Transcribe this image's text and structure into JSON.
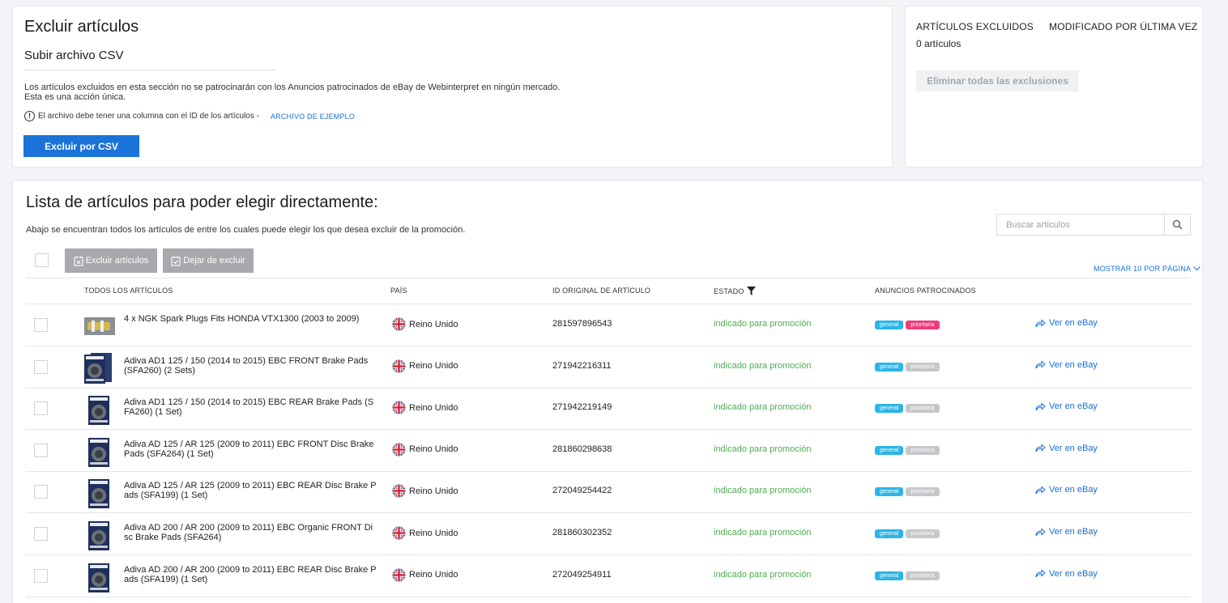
{
  "exclude_section": {
    "title": "Excluir artículos",
    "subtitle": "Subir archivo CSV",
    "description_line1": "Los artículos excluidos en esta sección no se patrocinarán con los Anuncios patrocinados de eBay de Webinterpret en ningún mercado.",
    "description_line2": "Esta es una acción única.",
    "note": "El archivo debe tener una columna con el ID de los artículos -",
    "sample_link": "ARCHIVO DE EJEMPLO",
    "button_label": "Excluir por CSV"
  },
  "summary": {
    "excluded_header": "ARTÍCULOS EXCLUIDOS",
    "modified_header": "MODIFICADO POR ÚLTIMA VEZ",
    "excluded_count": "0 artículos",
    "remove_all_label": "Eliminar todas las exclusiones"
  },
  "list": {
    "title": "Lista de artículos para poder elegir directamente:",
    "subtitle": "Abajo se encuentran todos los artículos de entre los cuales puede elegir los que desea excluir de la promoción.",
    "search_placeholder": "Buscar artículos",
    "exclude_button": "Excluir artículos",
    "unexclude_button": "Dejar de excluir",
    "page_size_label": "MOSTRAR 10 POR PÁGINA",
    "columns": {
      "all_items": "TODOS LOS ARTÍCULOS",
      "country": "PAÍS",
      "item_id": "ID ORIGINAL DE ARTÍCULO",
      "status": "ESTADO",
      "sponsored_ads": "ANUNCIOS PATROCINADOS"
    },
    "badge_general": "general",
    "badge_priority": "prioritaria",
    "view_link": "Ver en eBay",
    "rows": [
      {
        "title": "4 x NGK Spark Plugs Fits HONDA VTX1300 (2003 to 2009)",
        "country": "Reino Unido",
        "item_id": "281597896543",
        "status": "indicado para promoción",
        "priority_active": true,
        "thumb": "spark"
      },
      {
        "title": "Adiva AD1 125 / 150 (2014 to 2015) EBC FRONT Brake Pads (SFA260) (2 Sets)",
        "country": "Reino Unido",
        "item_id": "271942216311",
        "status": "indicado para promoción",
        "priority_active": false,
        "thumb": "pads2"
      },
      {
        "title": "Adiva AD1 125 / 150 (2014 to 2015) EBC REAR Brake Pads (SFA260) (1 Set)",
        "country": "Reino Unido",
        "item_id": "271942219149",
        "status": "indicado para promoción",
        "priority_active": false,
        "thumb": "pads"
      },
      {
        "title": "Adiva AD 125 / AR 125 (2009 to 2011) EBC FRONT Disc Brake Pads (SFA264) (1 Set)",
        "country": "Reino Unido",
        "item_id": "281860298638",
        "status": "indicado para promoción",
        "priority_active": false,
        "thumb": "pads"
      },
      {
        "title": "Adiva AD 125 / AR 125 (2009 to 2011) EBC REAR Disc Brake Pads (SFA199) (1 Set)",
        "country": "Reino Unido",
        "item_id": "272049254422",
        "status": "indicado para promoción",
        "priority_active": false,
        "thumb": "pads"
      },
      {
        "title": "Adiva AD 200 / AR 200 (2009 to 2011) EBC Organic FRONT Disc Brake Pads (SFA264)",
        "country": "Reino Unido",
        "item_id": "281860302352",
        "status": "indicado para promoción",
        "priority_active": false,
        "thumb": "pads"
      },
      {
        "title": "Adiva AD 200 / AR 200 (2009 to 2011) EBC REAR Disc Brake Pads (SFA199) (1 Set)",
        "country": "Reino Unido",
        "item_id": "272049254911",
        "status": "indicado para promoción",
        "priority_active": false,
        "thumb": "pads"
      }
    ]
  },
  "colors": {
    "primary": "#1a73d9",
    "link": "#1a6fd1",
    "status_green": "#4caf50",
    "badge_general": "#2bb5e8",
    "badge_priority_active": "#ee3c7a",
    "badge_priority_inactive": "#c5c7ca"
  }
}
